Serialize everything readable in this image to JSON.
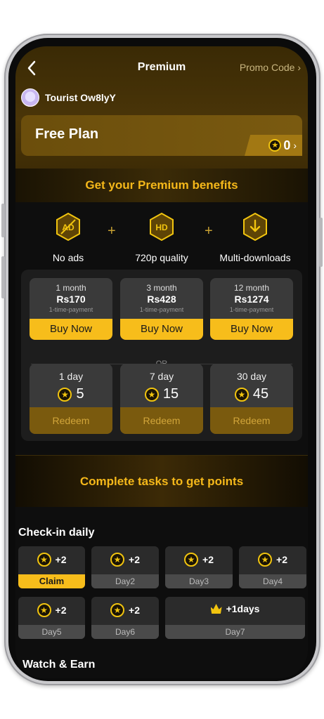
{
  "header": {
    "title": "Premium",
    "promo_code": "Promo Code",
    "user_name": "Tourist Ow8lyY"
  },
  "plan": {
    "name": "Free Plan",
    "points": "0"
  },
  "benefits": {
    "heading": "Get your Premium benefits",
    "items": [
      {
        "label": "No ads",
        "icon": "no-ads-icon"
      },
      {
        "label": "720p quality",
        "icon": "hd-icon"
      },
      {
        "label": "Multi-downloads",
        "icon": "download-icon"
      }
    ]
  },
  "paid_plans": [
    {
      "period": "1 month",
      "price": "Rs170",
      "note": "1-time-payment",
      "button": "Buy Now"
    },
    {
      "period": "3 month",
      "price": "Rs428",
      "note": "1-time-payment",
      "button": "Buy Now"
    },
    {
      "period": "12 month",
      "price": "Rs1274",
      "note": "1-time-payment",
      "button": "Buy Now"
    }
  ],
  "or_text": "OR",
  "point_plans": [
    {
      "period": "1 day",
      "cost": "5",
      "button": "Redeem"
    },
    {
      "period": "7 day",
      "cost": "15",
      "button": "Redeem"
    },
    {
      "period": "30 day",
      "cost": "45",
      "button": "Redeem"
    }
  ],
  "tasks_heading": "Complete tasks to get points",
  "checkin": {
    "title": "Check-in daily",
    "days": [
      {
        "reward": "+2",
        "label": "Claim"
      },
      {
        "reward": "+2",
        "label": "Day2"
      },
      {
        "reward": "+2",
        "label": "Day3"
      },
      {
        "reward": "+2",
        "label": "Day4"
      },
      {
        "reward": "+2",
        "label": "Day5"
      },
      {
        "reward": "+2",
        "label": "Day6"
      },
      {
        "reward": "+1days",
        "label": "Day7"
      }
    ]
  },
  "watch_earn_title": "Watch & Earn",
  "colors": {
    "accent": "#f7bd1b",
    "heading_gold": "#f5b81a",
    "redeem_bg": "#7a5a0e"
  }
}
